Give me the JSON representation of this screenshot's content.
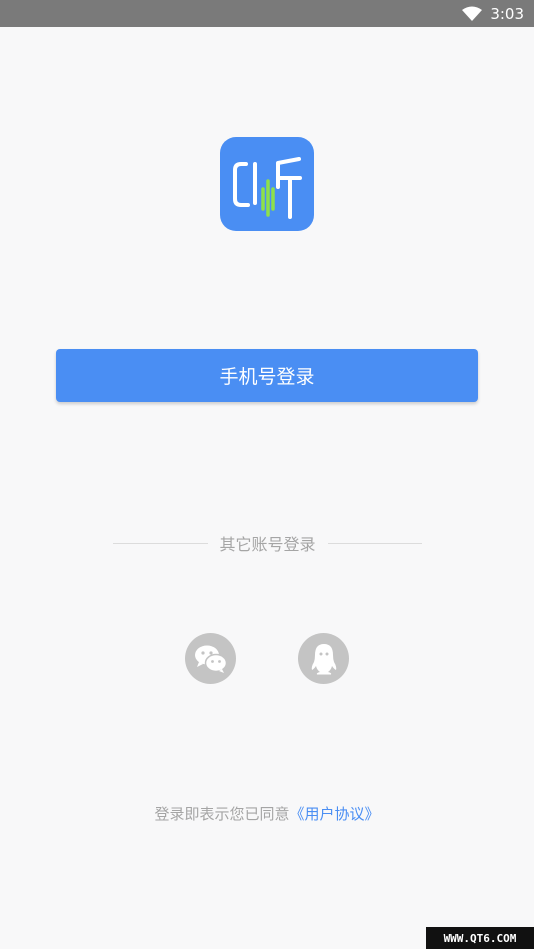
{
  "status_bar": {
    "time": "3:03",
    "wifi_icon": "wifi-icon"
  },
  "logo": {
    "icon": "app-logo-icon",
    "color": "#4a8ef3"
  },
  "login": {
    "phone_button_label": "手机号登录"
  },
  "other_login": {
    "label": "其它账号登录",
    "options": [
      {
        "icon": "wechat-icon"
      },
      {
        "icon": "qq-icon"
      }
    ]
  },
  "agreement": {
    "prefix": "登录即表示您已同意",
    "link": "《用户协议》"
  },
  "watermark": {
    "text": "WWW.QT6.COM"
  },
  "colors": {
    "accent": "#4a8ef3",
    "status_bar": "#7a7a7a",
    "muted_text": "#a5a5a5",
    "social_icon_bg": "#c4c4c4"
  }
}
